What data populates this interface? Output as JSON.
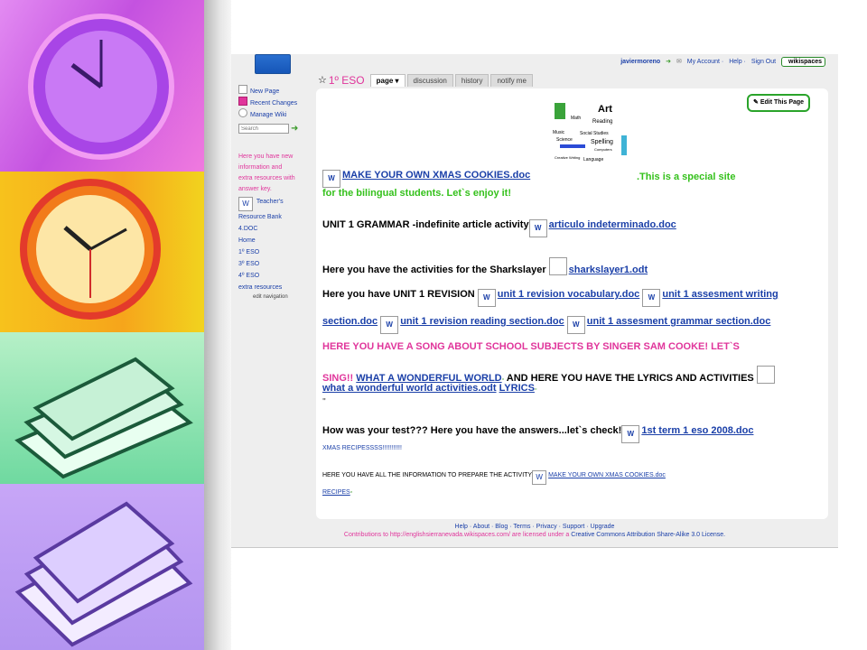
{
  "site": {
    "space_name": "1º ESO"
  },
  "user_bar": {
    "username": "javiermoreno",
    "my_account": "My Account",
    "help": "Help",
    "sign_out": "Sign Out",
    "wikispaces": "wikispaces"
  },
  "tabs": [
    {
      "label": "page ▾",
      "active": true
    },
    {
      "label": "discussion",
      "active": false
    },
    {
      "label": "history",
      "active": false
    },
    {
      "label": "notify me",
      "active": false
    }
  ],
  "nav": {
    "new_page": "New Page",
    "recent_changes": "Recent Changes",
    "manage_wiki": "Manage Wiki",
    "search_placeholder": "Search",
    "note_lines": [
      "Here you have new",
      "information and",
      "extra resources with",
      "answer key."
    ],
    "teachers": "Teacher's",
    "resource_bank": "Resource Bank",
    "doc4": "4.DOC",
    "home": "Home",
    "eso1": "1º ESO",
    "eso3": "3º ESO",
    "eso4": "4º ESO",
    "extra": "extra resources",
    "edit_navigation": "edit navigation"
  },
  "edit_button": "Edit This Page",
  "art_words": [
    "Art",
    "Math",
    "Reading",
    "Music",
    "Social Studies",
    "Science",
    "Spelling",
    "Computers",
    "Creative Writing",
    "Language"
  ],
  "content": {
    "xmas_link": "MAKE YOUR OWN XMAS COOKIES.doc",
    "special_site": ".This is a special site",
    "bilingual": "for the bilingual students. Let`s enjoy it!",
    "unit1_grammar": "UNIT 1 GRAMMAR -indefinite article activity",
    "unit1_grammar_link": "articulo indeterminado.doc",
    "sharkslayer_text": "Here you have the activities for the Sharkslayer",
    "sharkslayer_link": "sharkslayer1.odt",
    "revision_text": "Here you have UNIT 1 REVISION",
    "revision_vocab": "unit 1 revision vocabulary.doc",
    "assesment_writing": "unit 1 assesment writing",
    "section_doc": "section.doc",
    "revision_reading": "unit 1 revision reading section.doc",
    "assesment_grammar": "unit 1 assesment grammar section.doc",
    "song_line1": "HERE YOU HAVE A SONG ABOUT SCHOOL SUBJECTS BY SINGER SAM COOKE! LET`S",
    "song_sing": "SING!!",
    "wonderful_world": "WHAT A WONDERFUL WORLD",
    "lyrics_text": "AND HERE YOU HAVE THE LYRICS AND ACTIVITIES",
    "wonderful_activities": "what a wonderful world activities.odt",
    "lyrics_link": "LYRICS",
    "test_text": "How was your test??? Here you have the answers...let`s check!",
    "test_link": "1st term 1 eso 2008.doc",
    "xmas_recipes": "XMAS RECIPESSSS!!!!!!!!!!!",
    "info_text": "HERE YOU HAVE ALL THE INFORMATION TO PREPARE THE ACTIVITY",
    "info_link": "MAKE YOUR OWN XMAS COOKIES.doc",
    "recipes": "RECIPES"
  },
  "footer": {
    "links": "Help · About · Blog · Terms · Privacy · Support · Upgrade",
    "license_prefix": "Contributions to http://englishsierranevada.wikispaces.com/ are licensed under a",
    "license_link": "Creative Commons Attribution Share-Alike 3.0 License."
  },
  "colors": {
    "accent_pink": "#e0359b",
    "link_blue": "#1a3fa8",
    "green": "#35c11c"
  }
}
